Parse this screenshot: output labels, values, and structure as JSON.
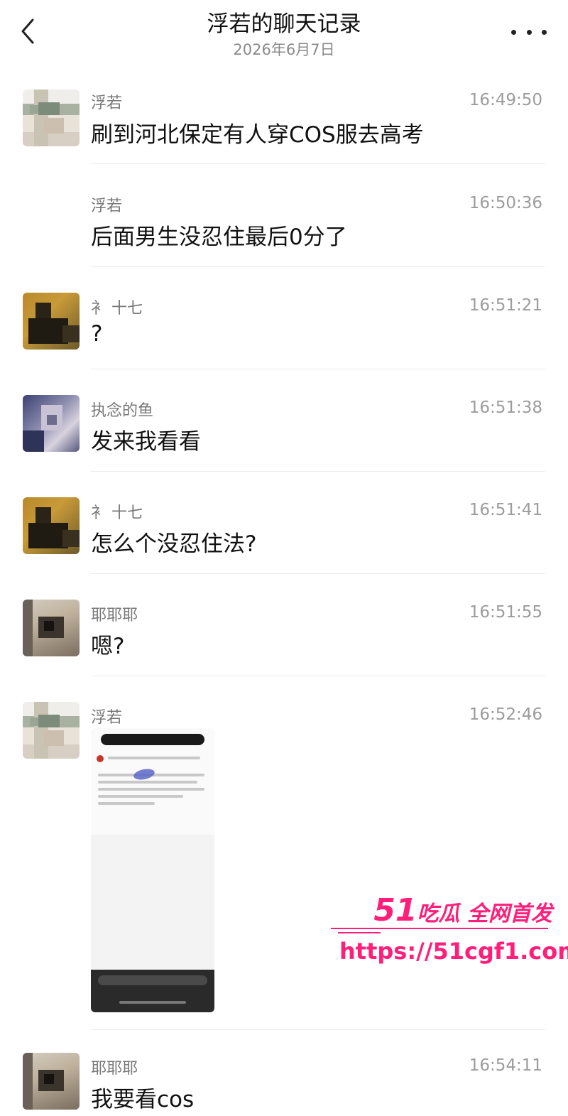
{
  "header": {
    "title": "浮若的聊天记录",
    "date": "2026年6月7日"
  },
  "messages": [
    {
      "sender": "浮若",
      "time": "16:49:50",
      "text": "刷到河北保定有人穿COS服去高考"
    },
    {
      "sender": "浮若",
      "time": "16:50:36",
      "text": "后面男生没忍住最后0分了"
    },
    {
      "sender": "衤 十七",
      "time": "16:51:21",
      "text": "?"
    },
    {
      "sender": "执念的鱼",
      "time": "16:51:38",
      "text": "发来我看看"
    },
    {
      "sender": "衤 十七",
      "time": "16:51:41",
      "text": "怎么个没忍住法?"
    },
    {
      "sender": "耶耶耶",
      "time": "16:51:55",
      "text": "嗯?"
    },
    {
      "sender": "浮若",
      "time": "16:52:46",
      "text": ""
    },
    {
      "sender": "耶耶耶",
      "time": "16:54:11",
      "text": "我要看cos"
    }
  ],
  "watermark": {
    "brand_number": "51",
    "brand_text": "吃瓜 全网首发",
    "url": "https://51cgf1.com",
    "color": "#ff1f7a"
  },
  "icons": {
    "back": "chevron-left-icon",
    "more": "more-horizontal-icon"
  }
}
